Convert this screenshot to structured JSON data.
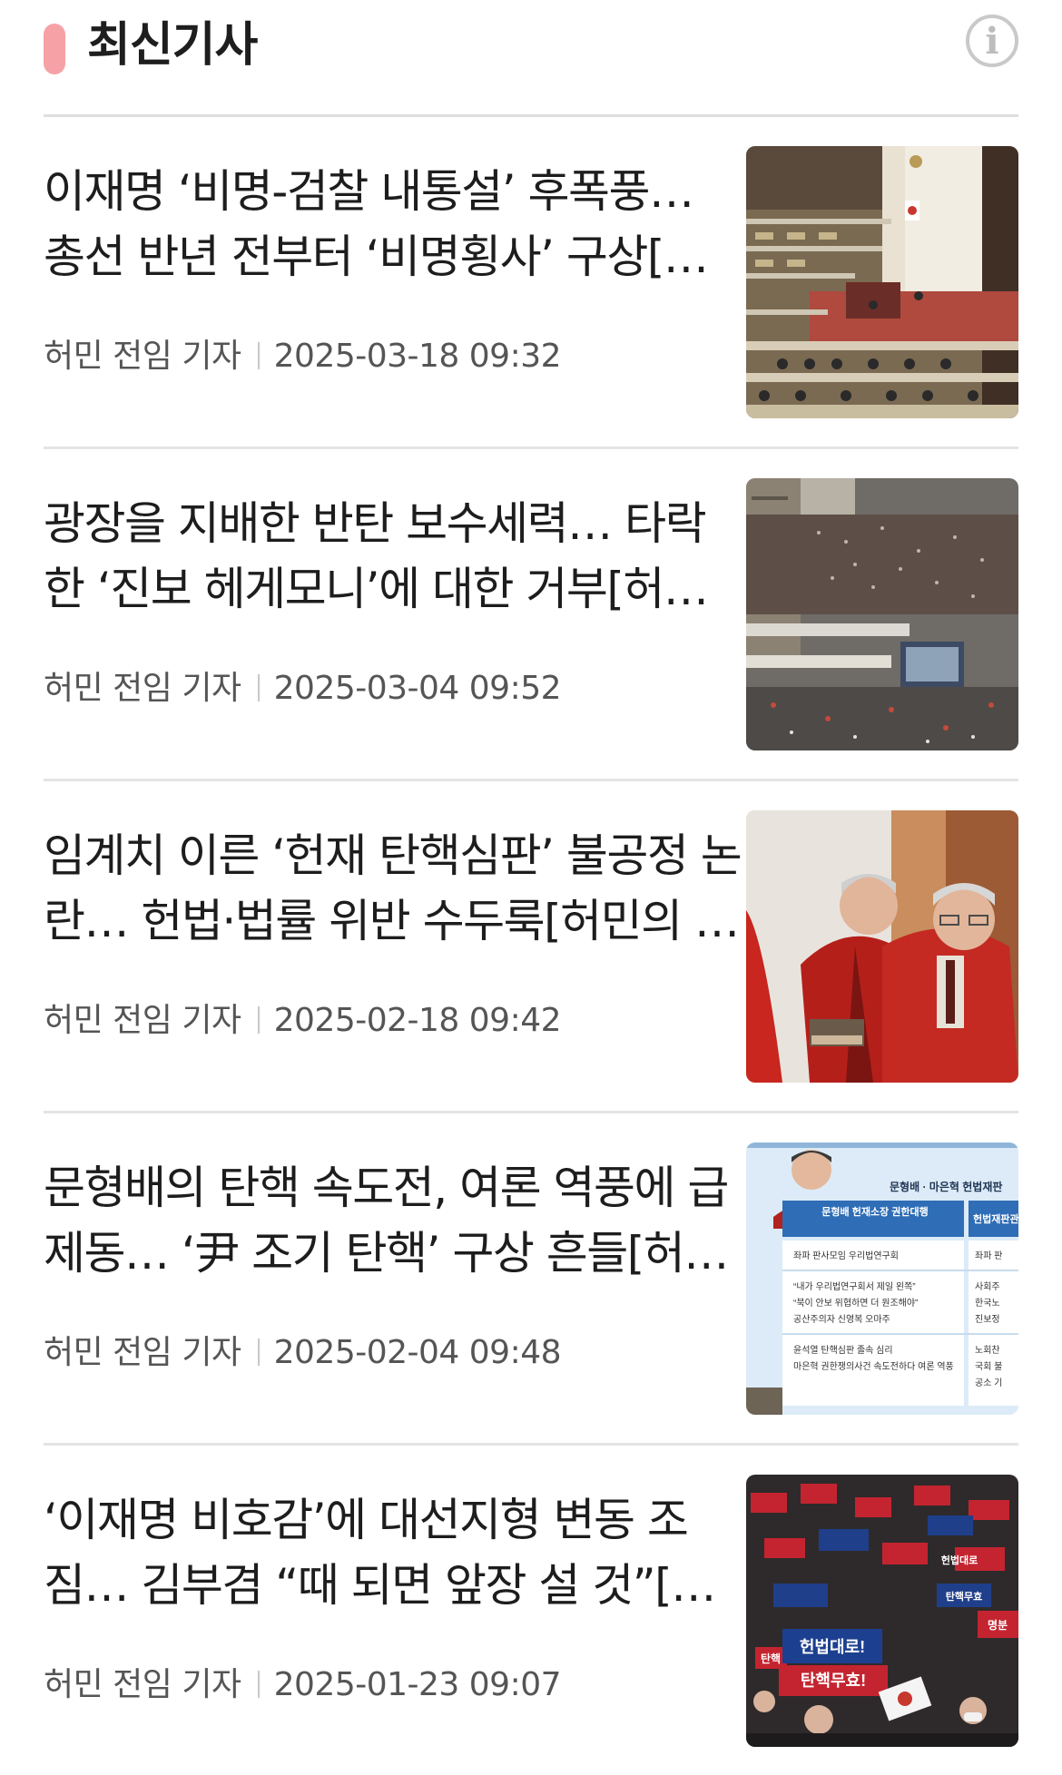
{
  "header": {
    "title": "최신기사",
    "info_icon": "info-icon",
    "accent_color": "#f6a1a6"
  },
  "articles": [
    {
      "headline": "이재명 ‘비명-검찰 내통설’ 후폭풍… 총선 반년 전부터 ‘비명횡사’ 구상[허민의 정치카페]",
      "author": "허민 전임 기자",
      "date": "2025-03-18 09:32",
      "thumbnail": "national-assembly-chamber-photo"
    },
    {
      "headline": "광장을 지배한 반탄 보수세력… 타락한 ‘진보 헤게모니’에 대한 거부[허민의 정치카페]",
      "author": "허민 전임 기자",
      "date": "2025-03-04 09:52",
      "thumbnail": "square-rally-crowd-photo"
    },
    {
      "headline": "임계치 이른 ‘헌재 탄핵심판’ 불공정 논란… 헌법·법률 위반 수두룩[허민의 정치카페]",
      "author": "허민 전임 기자",
      "date": "2025-02-18 09:42",
      "thumbnail": "constitutional-court-justices-photo"
    },
    {
      "headline": "문형배의 탄핵 속도전, 여론 역풍에 급제동… ‘尹 조기 탄핵’ 구상 흔들[허민의 정치카페]",
      "author": "허민 전임 기자",
      "date": "2025-02-04 09:48",
      "thumbnail": "infographic-image"
    },
    {
      "headline": "‘이재명 비호감’에 대선지형 변동 조짐… 김부겸 “때 되면 앞장 설 것”[허민의 정치카페]",
      "author": "허민 전임 기자",
      "date": "2025-01-23 09:07",
      "thumbnail": "protest-signs-crowd-photo"
    }
  ],
  "infographic": {
    "heading": "문형배 · 마은혁 헌법재판",
    "col1_title": "문형배 헌재소장 권한대행",
    "col2_title": "헌법재판관",
    "col1_rows": [
      "좌파 판사모임 우리법연구회",
      "“내가 우리법연구회서 제일 왼쪽”",
      "“북이 안보 위협하면 더 원조해야”",
      "공산주의자 신영복 오마주",
      "윤석열 탄핵심판 졸속 심리",
      "마은혁 권한쟁의사건 속도전하다 여론 역풍"
    ],
    "col2_rows": [
      "좌파 판",
      "사회주",
      "한국노",
      "진보정",
      "노회찬",
      "국회 불",
      "공소 기"
    ]
  },
  "protest_signs": [
    "헌법대로!",
    "탄핵무효!",
    "헌법대로",
    "탄핵무효",
    "명분",
    "탄핵"
  ]
}
